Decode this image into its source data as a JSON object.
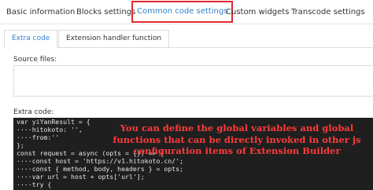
{
  "top_tabs": [
    {
      "label": "Basic information",
      "active": false
    },
    {
      "label": "Blocks settings",
      "active": false
    },
    {
      "label": "Common code settings",
      "active": true
    },
    {
      "label": "Custom widgets",
      "active": false
    },
    {
      "label": "Transcode settings",
      "active": false
    }
  ],
  "sub_tabs": [
    {
      "label": "Extra code",
      "active": true
    },
    {
      "label": "Extension handler function",
      "active": false
    }
  ],
  "source_files": {
    "label": "Source files:"
  },
  "extra_code": {
    "label": "Extra code:",
    "lines": [
      "var yiYanResult = {",
      "····hitokoto: '',",
      "····from:''",
      "};",
      "const request = async (opts = {}) => {",
      "····const host = 'https://v1.hitokoto.cn/';",
      "····const { method, body, headers } = opts;",
      "····var url = host + opts['url'];",
      "····try {"
    ]
  },
  "annotation": {
    "text": "You can define the global variables and global functions that can be directly invoked in other js configuration items of Extension Builder",
    "color": "#ff3b3b"
  },
  "colors": {
    "accent": "#2f7fcf",
    "highlight_border": "#e2282e",
    "code_bg": "#1f1f1f"
  }
}
